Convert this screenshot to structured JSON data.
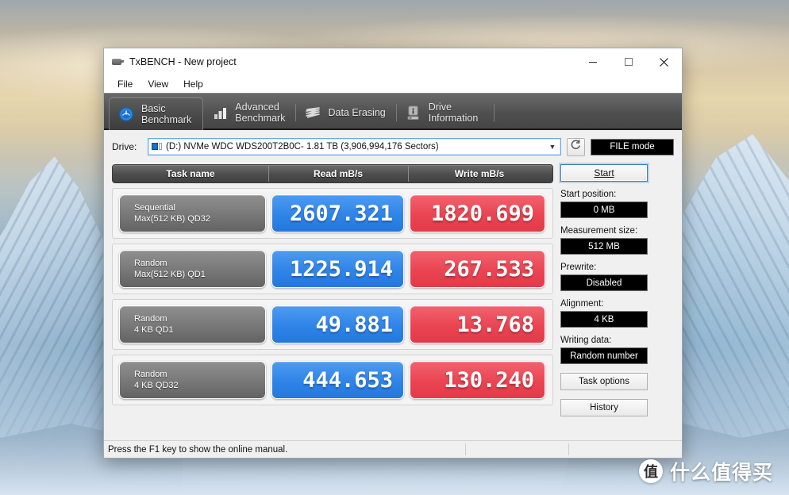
{
  "window": {
    "title": "TxBENCH - New project",
    "app_icon": "drive-benchmark-icon",
    "controls": {
      "minimize": "minimize-icon",
      "maximize": "maximize-icon",
      "close": "close-icon"
    }
  },
  "menubar": {
    "items": [
      "File",
      "View",
      "Help"
    ]
  },
  "tabs": [
    {
      "label": "Basic\nBenchmark",
      "icon": "power-gauge-icon",
      "active": true
    },
    {
      "label": "Advanced\nBenchmark",
      "icon": "bar-chart-icon",
      "active": false
    },
    {
      "label": "Data Erasing",
      "icon": "eraser-wave-icon",
      "active": false
    },
    {
      "label": "Drive\nInformation",
      "icon": "drive-info-icon",
      "active": false
    }
  ],
  "drive_row": {
    "label": "Drive:",
    "selected": "(D:) NVMe WDC WDS200T2B0C-  1.81 TB (3,906,994,176 Sectors)",
    "caret": "chevron-down-icon",
    "refresh_icon": "refresh-icon",
    "mode_button": "FILE mode"
  },
  "results": {
    "columns": [
      "Task name",
      "Read mB/s",
      "Write mB/s"
    ],
    "rows": [
      {
        "task_line1": "Sequential",
        "task_line2": "Max(512 KB) QD32",
        "read": "2607.321",
        "write": "1820.699"
      },
      {
        "task_line1": "Random",
        "task_line2": "Max(512 KB) QD1",
        "read": "1225.914",
        "write": "267.533"
      },
      {
        "task_line1": "Random",
        "task_line2": "4 KB QD1",
        "read": "49.881",
        "write": "13.768"
      },
      {
        "task_line1": "Random",
        "task_line2": "4 KB QD32",
        "read": "444.653",
        "write": "130.240"
      }
    ]
  },
  "sidebar": {
    "start_button": "Start",
    "fields": [
      {
        "label": "Start position:",
        "value": "0 MB"
      },
      {
        "label": "Measurement size:",
        "value": "512 MB"
      },
      {
        "label": "Prewrite:",
        "value": "Disabled"
      },
      {
        "label": "Alignment:",
        "value": "4 KB"
      },
      {
        "label": "Writing data:",
        "value": "Random number"
      }
    ],
    "buttons": [
      "Task options",
      "History"
    ]
  },
  "statusbar": {
    "text": "Press the F1 key to show the online manual."
  },
  "watermark": {
    "badge": "值",
    "text": "什么值得买"
  },
  "colors": {
    "read_blue": "#2f84e8",
    "write_red": "#ea4452",
    "task_gray": "#7b7b7b",
    "header_dark": "#4e4e4e",
    "window_bg": "#f0f0f0",
    "value_black": "#000000"
  },
  "chart_data": {
    "type": "table",
    "title": "TxBENCH Basic Benchmark results",
    "columns": [
      "Task name",
      "Read mB/s",
      "Write mB/s"
    ],
    "categories": [
      "Sequential Max(512 KB) QD32",
      "Random Max(512 KB) QD1",
      "Random 4 KB QD1",
      "Random 4 KB QD32"
    ],
    "series": [
      {
        "name": "Read mB/s",
        "values": [
          2607.321,
          1225.914,
          49.881,
          444.653
        ]
      },
      {
        "name": "Write mB/s",
        "values": [
          1820.699,
          267.533,
          13.768,
          130.24
        ]
      }
    ]
  }
}
